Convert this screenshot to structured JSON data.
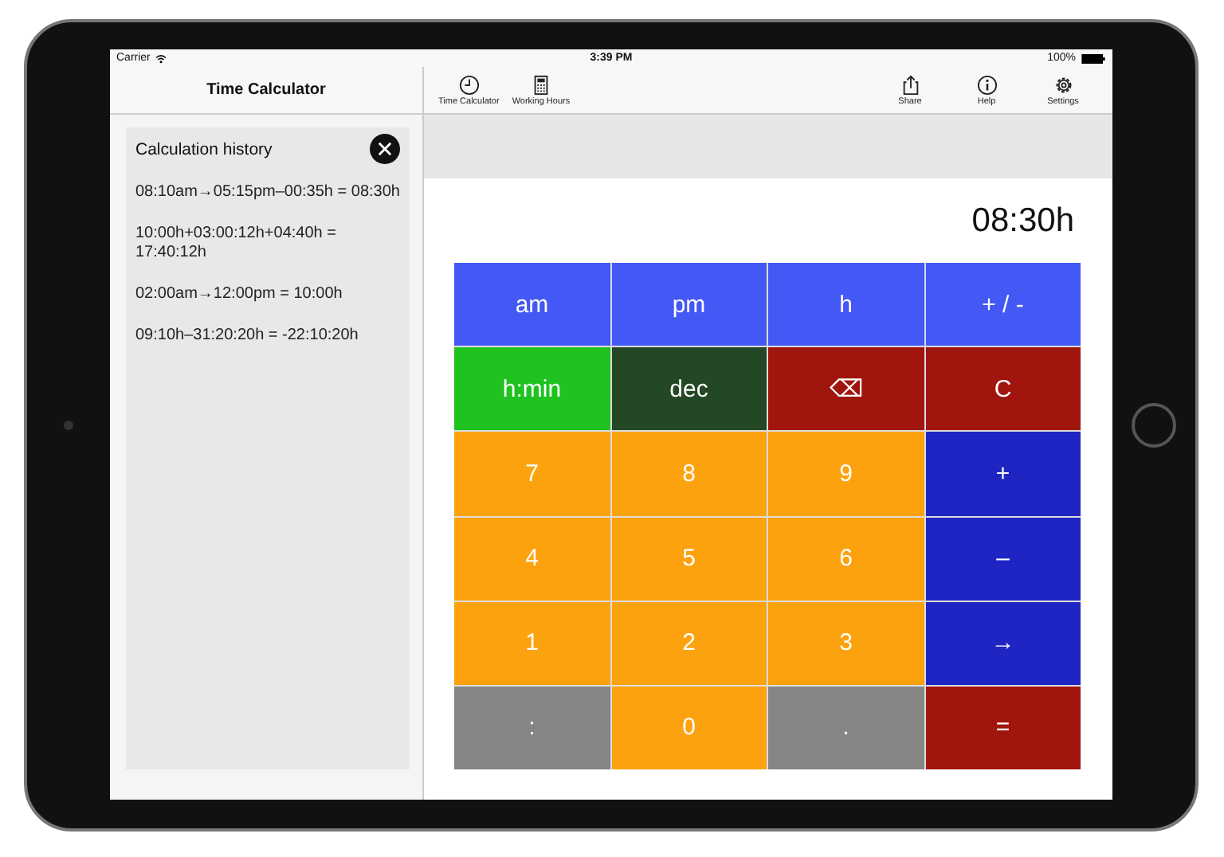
{
  "status_bar": {
    "carrier": "Carrier",
    "time": "3:39 PM",
    "battery": "100%"
  },
  "sidebar": {
    "title": "Time Calculator",
    "panel_title": "Calculation history",
    "history": [
      "08:10am→05:15pm–00:35h = 08:30h",
      "10:00h+03:00:12h+04:40h = 17:40:12h",
      "02:00am→12:00pm = 10:00h",
      "09:10h–31:20:20h = -22:10:20h"
    ]
  },
  "toolbar_left": [
    {
      "kind": "clock",
      "label": "Time Calculator"
    },
    {
      "kind": "calculator",
      "label": "Working Hours"
    }
  ],
  "toolbar_right": [
    {
      "kind": "share",
      "label": "Share"
    },
    {
      "kind": "info",
      "label": "Help"
    },
    {
      "kind": "gear",
      "label": "Settings"
    }
  ],
  "display": "08:30h",
  "keys": [
    {
      "label": "am",
      "color": "#4358f5"
    },
    {
      "label": "pm",
      "color": "#4358f5"
    },
    {
      "label": "h",
      "color": "#4358f5"
    },
    {
      "label": "+ / -",
      "color": "#4358f5"
    },
    {
      "label": "h:min",
      "color": "#1fc21f"
    },
    {
      "label": "dec",
      "color": "#244726"
    },
    {
      "label": "⌫",
      "color": "#a0150e"
    },
    {
      "label": "C",
      "color": "#a0150e"
    },
    {
      "label": "7",
      "color": "#fca20f"
    },
    {
      "label": "8",
      "color": "#fca20f"
    },
    {
      "label": "9",
      "color": "#fca20f"
    },
    {
      "label": "+",
      "color": "#1f25c2"
    },
    {
      "label": "4",
      "color": "#fca20f"
    },
    {
      "label": "5",
      "color": "#fca20f"
    },
    {
      "label": "6",
      "color": "#fca20f"
    },
    {
      "label": "–",
      "color": "#1f25c2"
    },
    {
      "label": "1",
      "color": "#fca20f"
    },
    {
      "label": "2",
      "color": "#fca20f"
    },
    {
      "label": "3",
      "color": "#fca20f"
    },
    {
      "label": "→",
      "color": "#1f25c2"
    },
    {
      "label": ":",
      "color": "#858585"
    },
    {
      "label": "0",
      "color": "#fca20f"
    },
    {
      "label": ".",
      "color": "#858585"
    },
    {
      "label": "=",
      "color": "#a0150e"
    }
  ]
}
